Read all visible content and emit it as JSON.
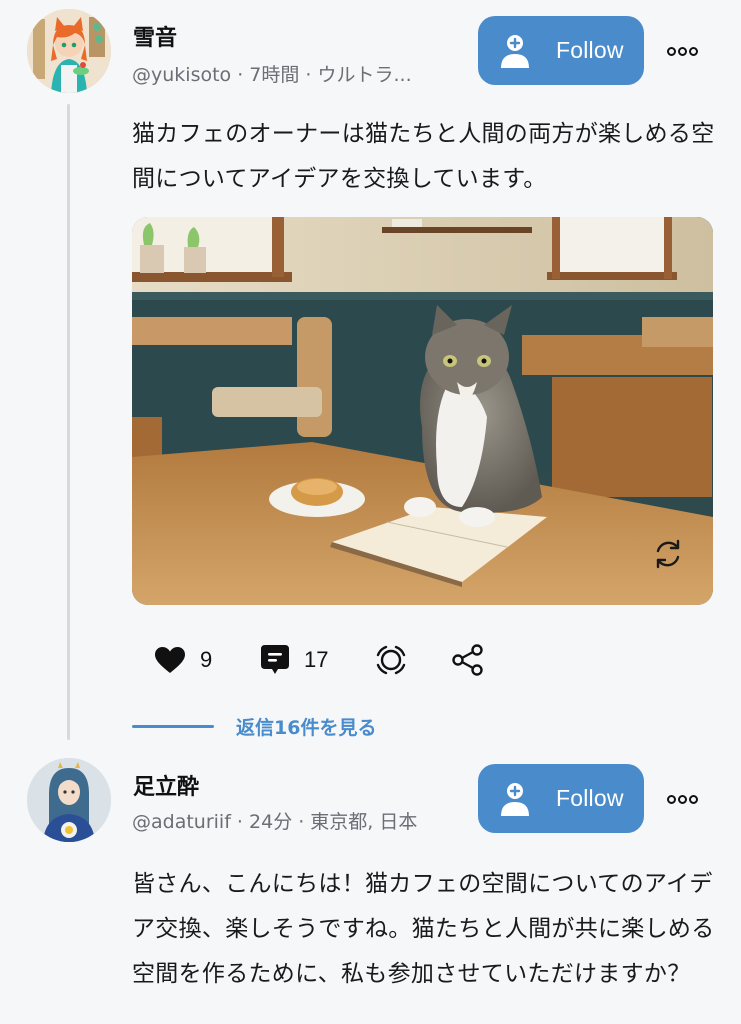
{
  "posts": [
    {
      "author": {
        "display_name": "雪音",
        "meta": "@yukisoto · 7時間 · ウルトラ...",
        "avatar_icon": "avatar-anime-cat-girl"
      },
      "follow_label": "Follow",
      "more_icon": "more-options-icon",
      "text": "猫カフェのオーナーは猫たちと人間の両方が楽しめる空間についてアイデアを交換しています。",
      "image": {
        "description": "Tabby cat sitting at a wooden cafe table with an open book and a bread roll on a plate",
        "overlay_icon": "regenerate-icon"
      },
      "actions": {
        "likes": "9",
        "comments": "17",
        "repost_icon": "repost-icon",
        "share_icon": "share-icon"
      },
      "view_replies_label": "返信16件を見る"
    },
    {
      "author": {
        "display_name": "足立酔",
        "meta": "@adaturiif · 24分 · 東京都, 日本",
        "avatar_icon": "avatar-blue-hair-girl"
      },
      "follow_label": "Follow",
      "more_icon": "more-options-icon",
      "text": "皆さん、こんにちは！猫カフェの空間についてのアイデア交換、楽しそうですね。猫たちと人間が共に楽しめる空間を作るために、私も参加させていただけますか？"
    }
  ],
  "colors": {
    "accent": "#4a8ccb",
    "background": "#f6f7f9",
    "meta_text": "#6b6e75"
  }
}
